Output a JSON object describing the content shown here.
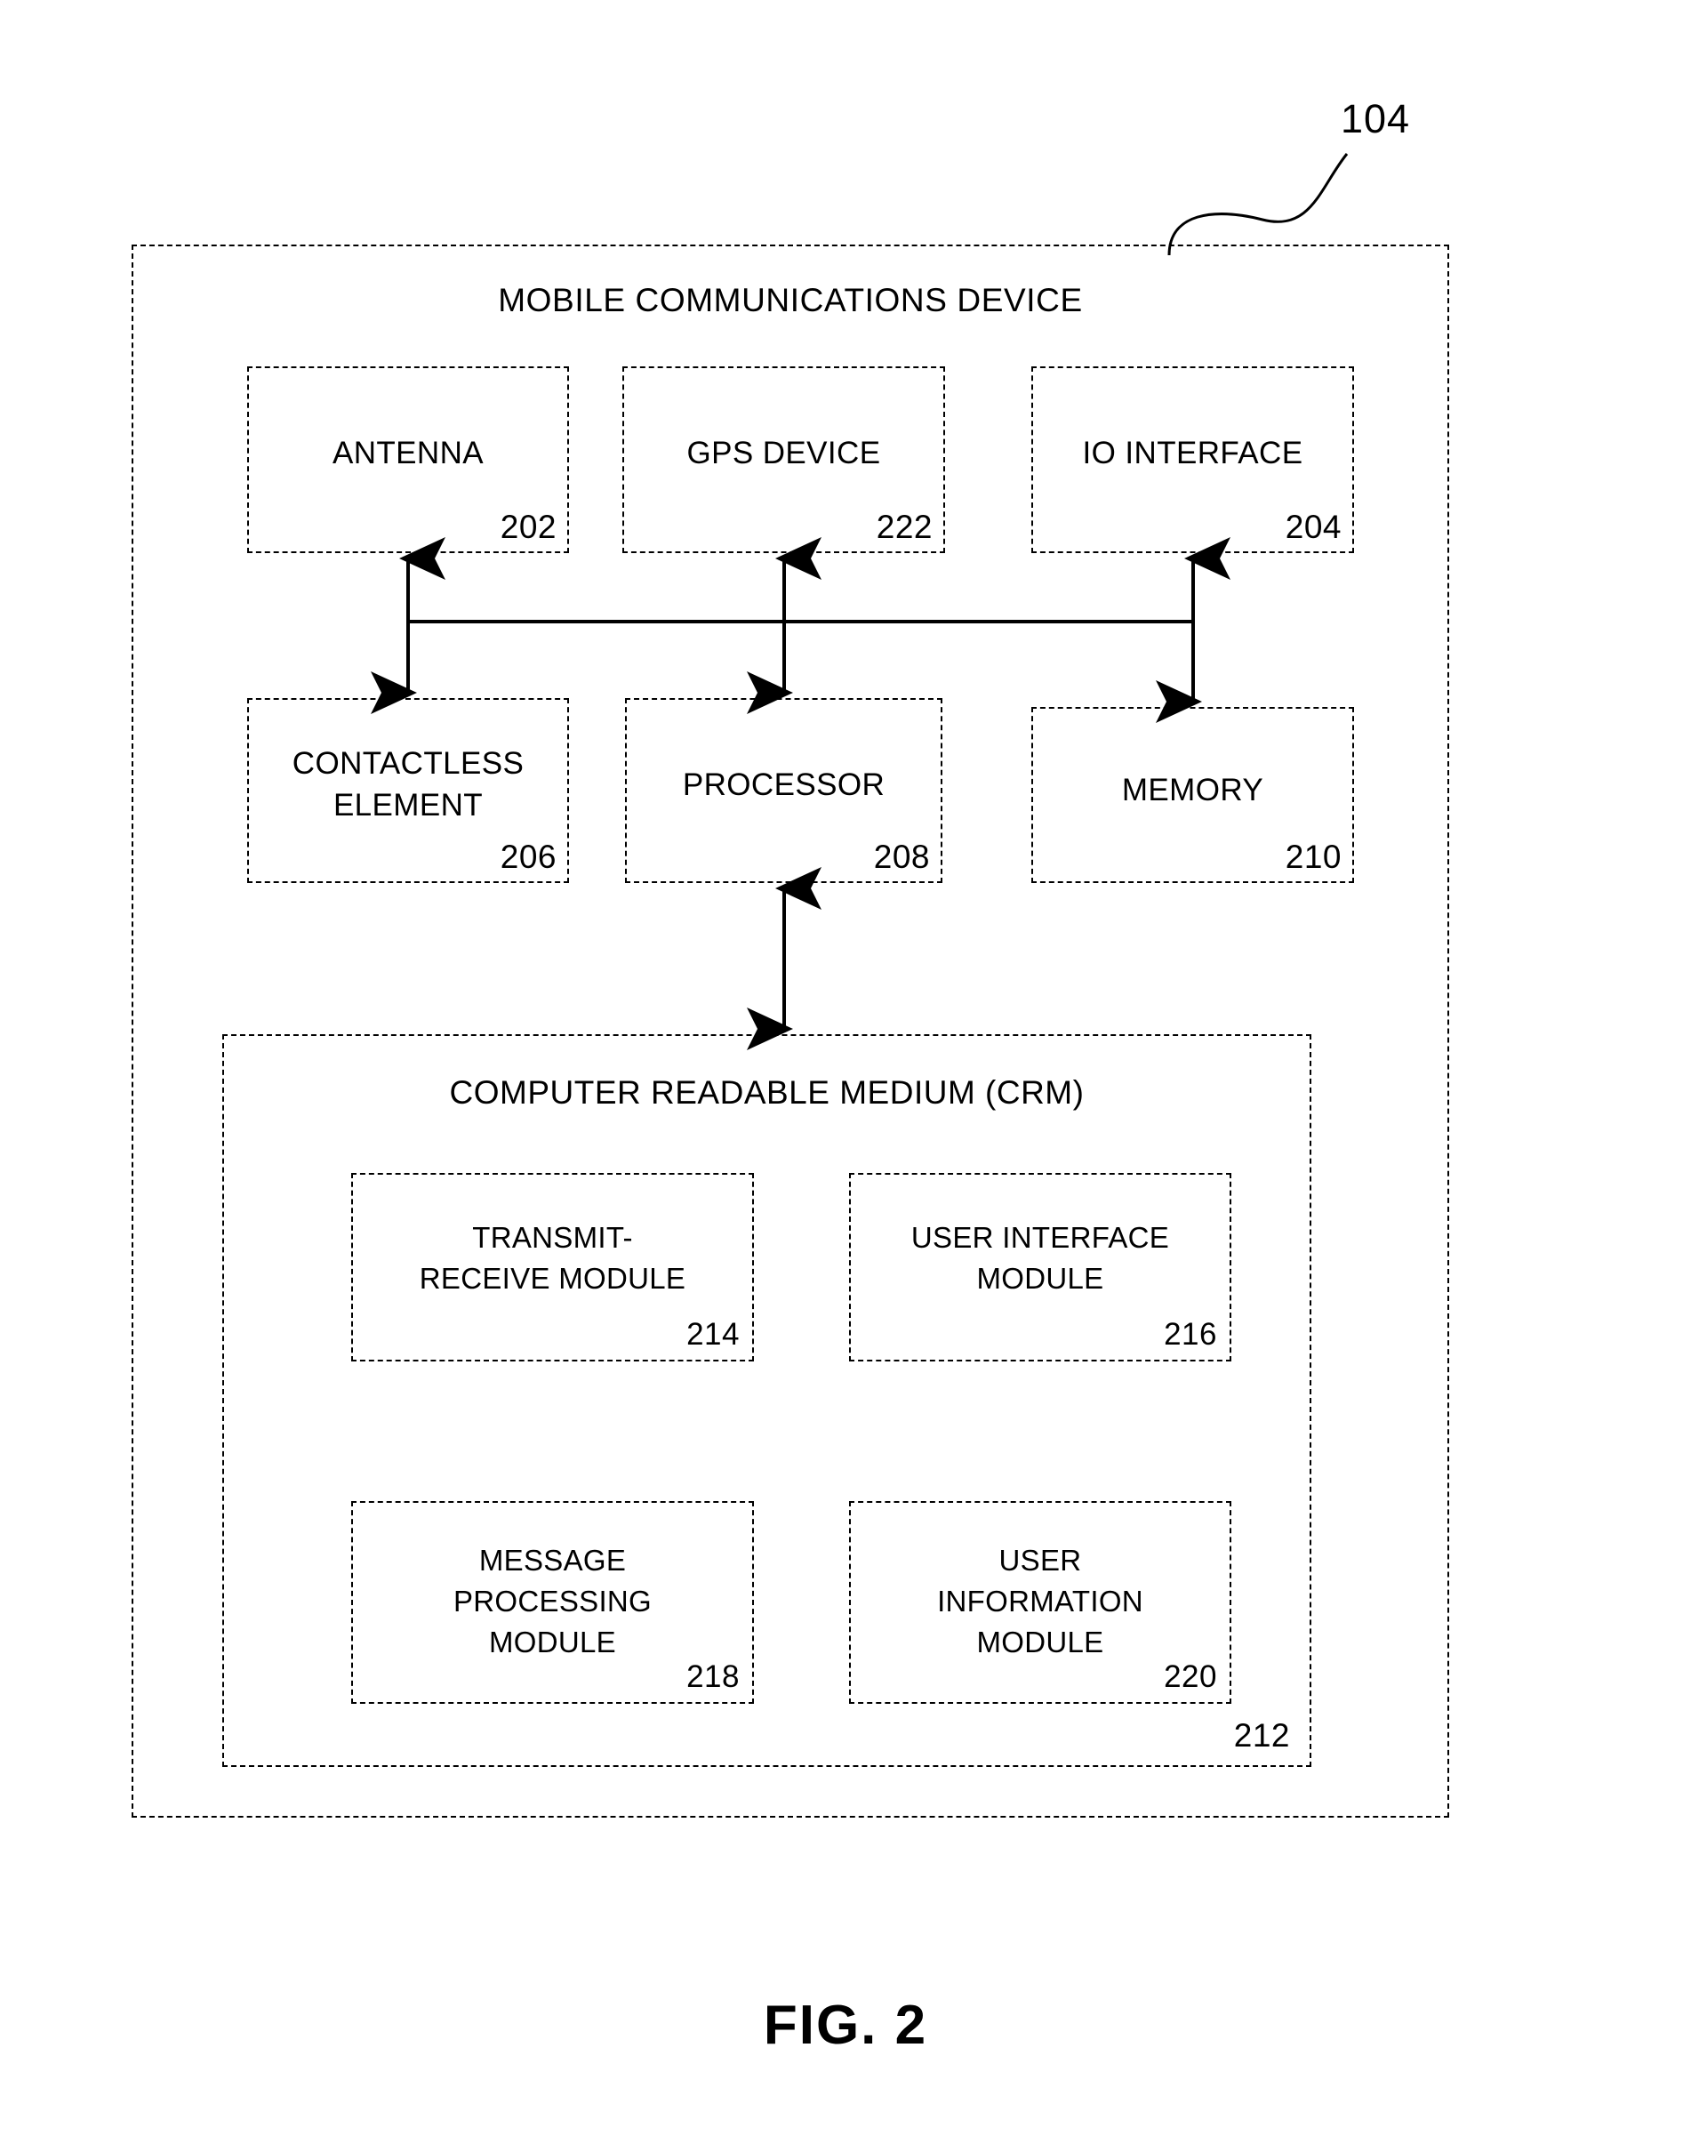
{
  "figure": {
    "caption": "FIG. 2",
    "callout_ref": "104"
  },
  "device": {
    "title": "MOBILE COMMUNICATIONS DEVICE",
    "row1": [
      {
        "label": "ANTENNA",
        "ref": "202"
      },
      {
        "label": "GPS DEVICE",
        "ref": "222"
      },
      {
        "label": "IO INTERFACE",
        "ref": "204"
      }
    ],
    "row2": [
      {
        "label_line1": "CONTACTLESS",
        "label_line2": "ELEMENT",
        "ref": "206"
      },
      {
        "label": "PROCESSOR",
        "ref": "208"
      },
      {
        "label": "MEMORY",
        "ref": "210"
      }
    ]
  },
  "crm": {
    "title": "COMPUTER READABLE MEDIUM (CRM)",
    "ref": "212",
    "modules": [
      {
        "label_line1": "TRANSMIT-",
        "label_line2": "RECEIVE MODULE",
        "label_line3": "",
        "ref": "214"
      },
      {
        "label_line1": "USER INTERFACE",
        "label_line2": "MODULE",
        "label_line3": "",
        "ref": "216"
      },
      {
        "label_line1": "MESSAGE",
        "label_line2": "PROCESSING",
        "label_line3": "MODULE",
        "ref": "218"
      },
      {
        "label_line1": "USER",
        "label_line2": "INFORMATION",
        "label_line3": "MODULE",
        "ref": "220"
      }
    ]
  },
  "colors": {
    "line": "#000000",
    "background": "#ffffff"
  }
}
